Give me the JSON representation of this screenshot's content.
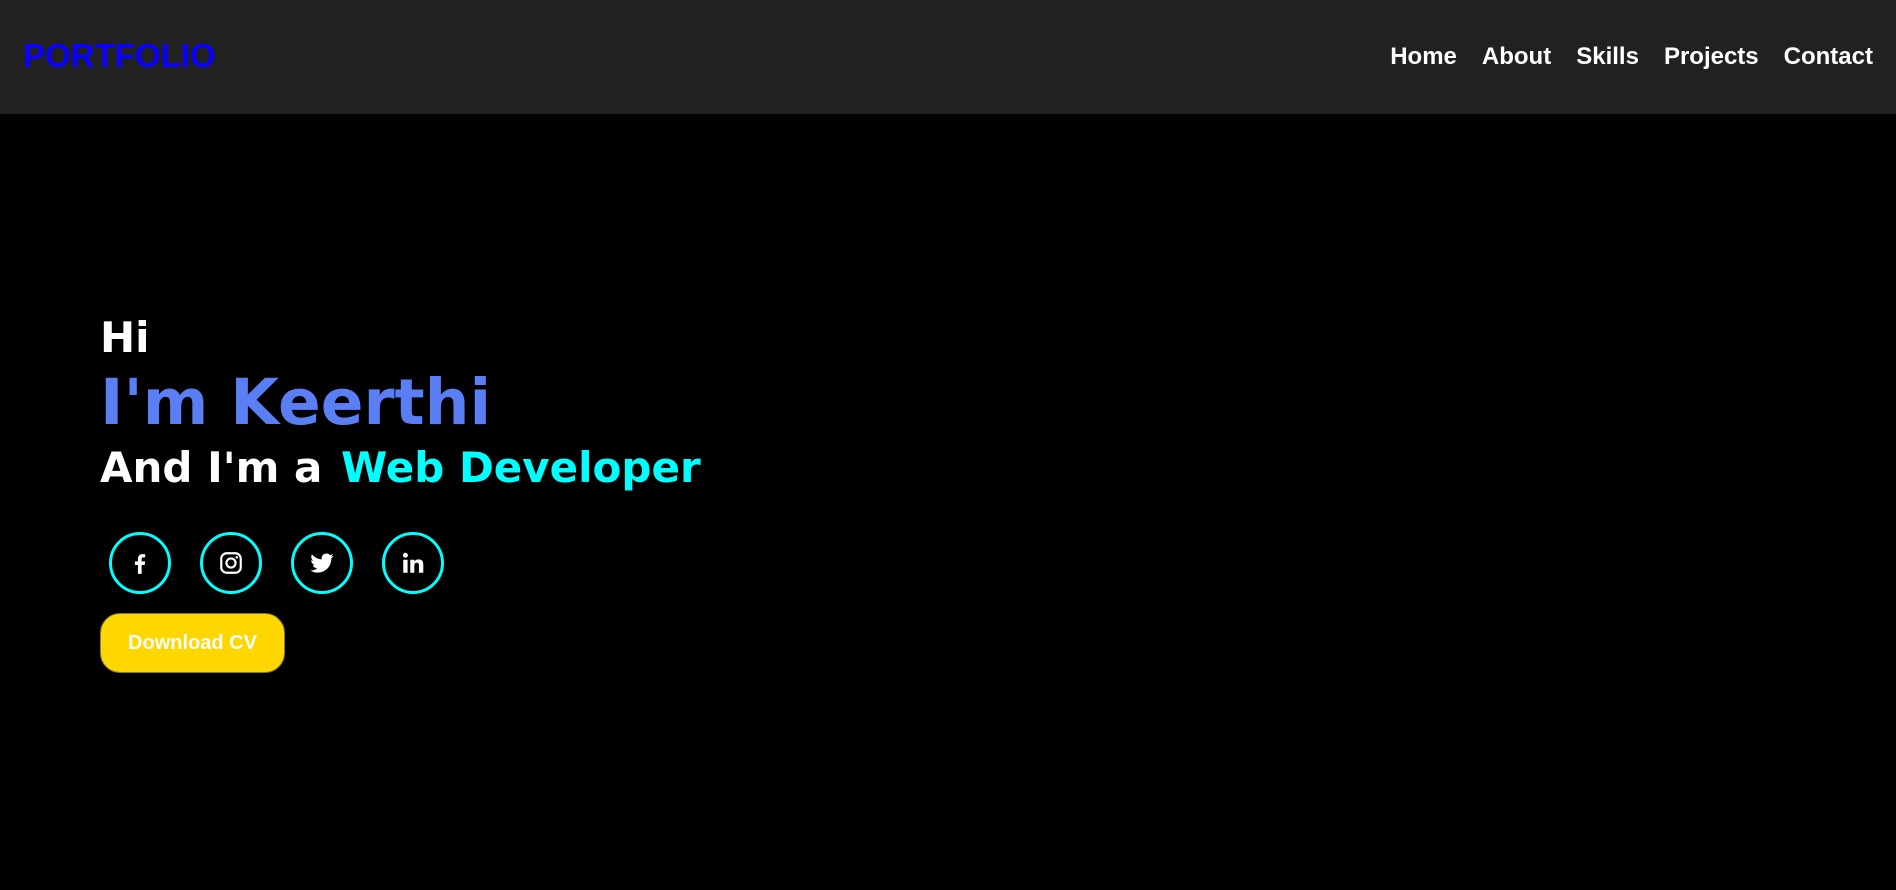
{
  "header": {
    "logo": "PORTFOLIO",
    "nav": [
      "Home",
      "About",
      "Skills",
      "Projects",
      "Contact"
    ]
  },
  "hero": {
    "greeting": "Hi",
    "name": "I'm Keerthi",
    "role_prefix": "And I'm a",
    "profession": "Web Developer"
  },
  "socials": [
    {
      "icon": "facebook-icon"
    },
    {
      "icon": "instagram-icon"
    },
    {
      "icon": "twitter-icon"
    },
    {
      "icon": "linkedin-icon"
    }
  ],
  "cv_button": {
    "label": "Download CV"
  },
  "colors": {
    "background": "#000000",
    "header_bg": "#212121",
    "logo": "#0a00ff",
    "name": "#5a7ff5",
    "accent": "#00ffff",
    "button_bg": "#ffd700"
  }
}
